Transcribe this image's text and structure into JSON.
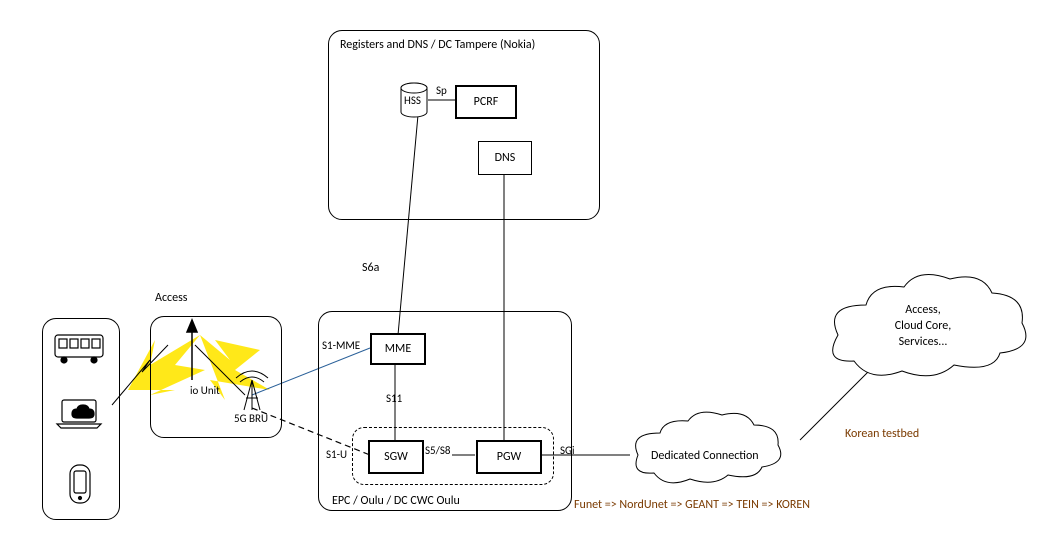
{
  "groups": {
    "top_title": "Registers and DNS / DC Tampere (Nokia)",
    "bottom_title": "EPC / Oulu / DC CWC Oulu",
    "access_title": "Access"
  },
  "nodes": {
    "hss": "HSS",
    "pcrf": "PCRF",
    "dns": "DNS",
    "mme": "MME",
    "sgw": "SGW",
    "pgw": "PGW"
  },
  "links": {
    "sp": "Sp",
    "s6a": "S6a",
    "s1mme": "S1-MME",
    "s11": "S11",
    "s1u": "S1-U",
    "s5s8": "S5/S8",
    "sgi": "SGi"
  },
  "access": {
    "radio_unit": "io Unit",
    "bru": "5G BRU"
  },
  "clouds": {
    "dedicated": "Dedicated Connection",
    "korea_lines": [
      "Access,",
      "Cloud Core,",
      "Services..."
    ],
    "korea_label": "Korean testbed"
  },
  "footer_path": "Funet => NordUnet => GEANT => TEIN => KOREN"
}
